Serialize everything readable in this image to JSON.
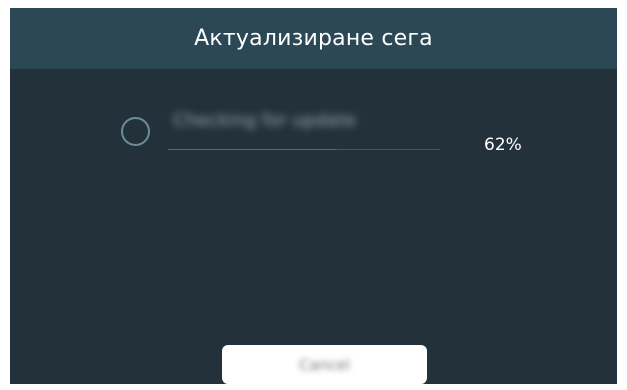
{
  "dialog": {
    "title": "Актуализиране сега"
  },
  "progress": {
    "status_text": "Checking for update",
    "percent_label": "62%",
    "percent_value": 0.62
  },
  "actions": {
    "cancel_label": "Cancel"
  },
  "icons": {
    "spinner": "loading-spinner-icon"
  },
  "colors": {
    "dialog_background": "#22313a",
    "title_bar": "#2c4756",
    "spinner": "#6f8a98",
    "button": "#ffffff"
  }
}
